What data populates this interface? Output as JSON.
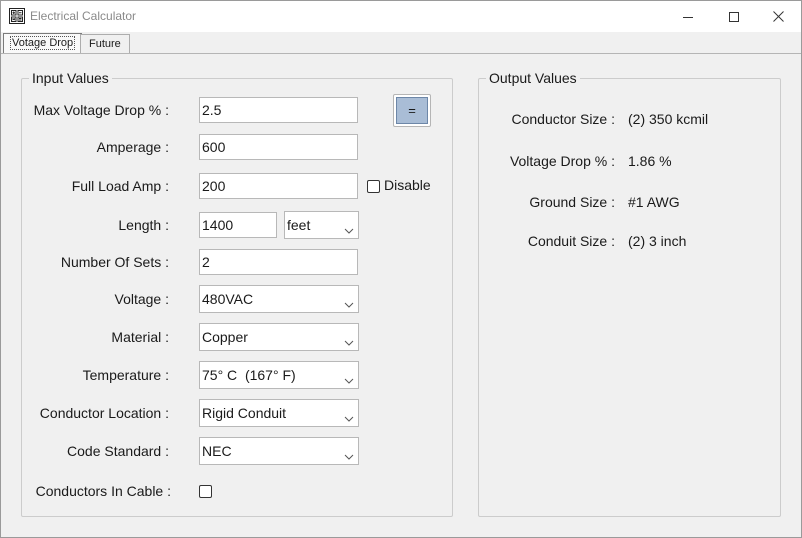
{
  "window": {
    "title": "Electrical Calculator"
  },
  "tabs": [
    {
      "label": "Votage Drop",
      "active": true
    },
    {
      "label": "Future",
      "active": false
    }
  ],
  "input": {
    "group_title": "Input Values",
    "max_voltage_drop": {
      "label": "Max Voltage Drop % :",
      "value": "2.5"
    },
    "amperage": {
      "label": "Amperage :",
      "value": "600"
    },
    "full_load_amp": {
      "label": "Full Load Amp :",
      "value": "200",
      "disable_label": "Disable",
      "disable_checked": false
    },
    "length": {
      "label": "Length :",
      "value": "1400",
      "unit": "feet"
    },
    "number_of_sets": {
      "label": "Number Of Sets :",
      "value": "2"
    },
    "voltage": {
      "label": "Voltage :",
      "value": "480VAC"
    },
    "material": {
      "label": "Material :",
      "value": "Copper"
    },
    "temperature": {
      "label": "Temperature :",
      "value": "75° C  (167° F)"
    },
    "conductor_location": {
      "label": "Conductor Location :",
      "value": "Rigid Conduit"
    },
    "code_standard": {
      "label": "Code Standard :",
      "value": "NEC"
    },
    "conductors_in_cable": {
      "label": "Conductors In Cable :",
      "checked": false
    },
    "calculate_label": "="
  },
  "output": {
    "group_title": "Output Values",
    "conductor_size": {
      "label": "Conductor Size :",
      "value": "(2) 350 kcmil"
    },
    "voltage_drop": {
      "label": "Voltage Drop % :",
      "value": "1.86 %"
    },
    "ground_size": {
      "label": "Ground Size :",
      "value": "#1 AWG"
    },
    "conduit_size": {
      "label": "Conduit Size :",
      "value": "(2) 3 inch"
    }
  },
  "icons": {
    "app": "calculator-icon",
    "minimize": "minimize-icon",
    "maximize": "maximize-icon",
    "close": "close-icon",
    "dropdown": "chevron-down-icon"
  }
}
